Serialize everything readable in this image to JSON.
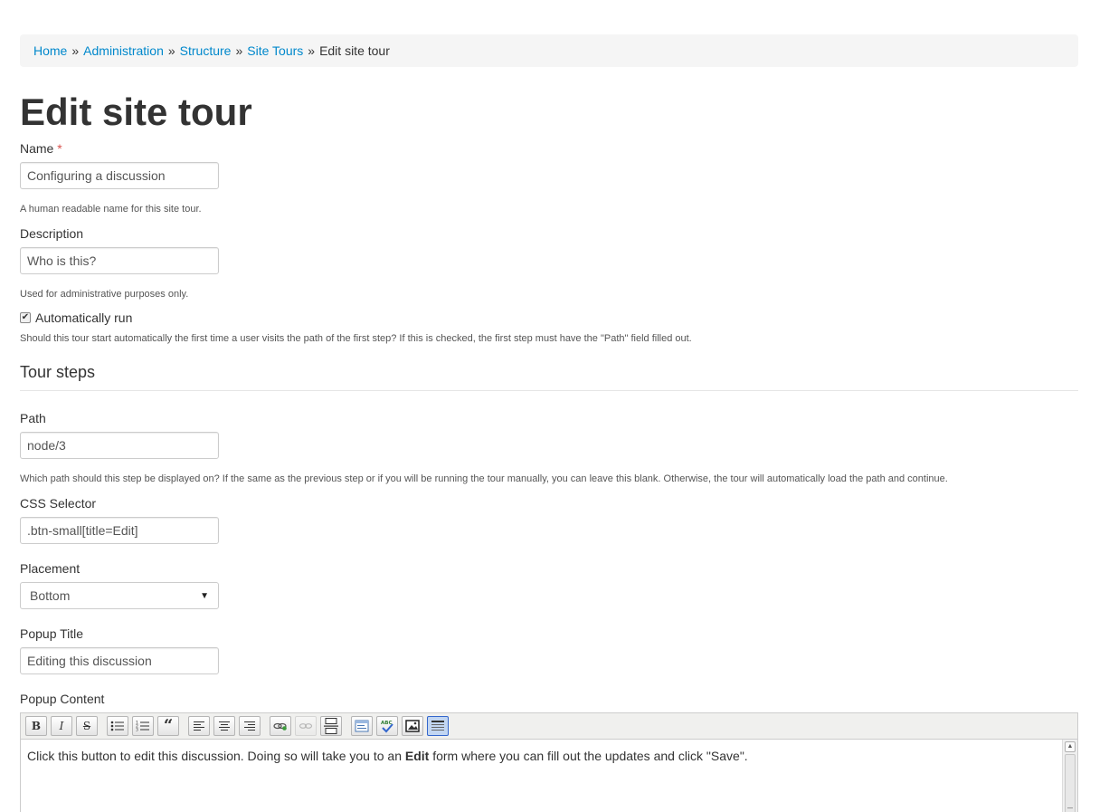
{
  "breadcrumb": {
    "items": [
      "Home",
      "Administration",
      "Structure",
      "Site Tours"
    ],
    "separator": "»",
    "current": "Edit site tour"
  },
  "page_title": "Edit site tour",
  "form": {
    "name": {
      "label": "Name",
      "required_marker": "*",
      "value": "Configuring a discussion",
      "help": "A human readable name for this site tour."
    },
    "description": {
      "label": "Description",
      "value": "Who is this?",
      "help": "Used for administrative purposes only."
    },
    "auto_run": {
      "label": "Automatically run",
      "checked": true,
      "help": "Should this tour start automatically the first time a user visits the path of the first step? If this is checked, the first step must have the \"Path\" field filled out."
    }
  },
  "tour_steps": {
    "heading": "Tour steps",
    "path": {
      "label": "Path",
      "value": "node/3",
      "help": "Which path should this step be displayed on? If the same as the previous step or if you will be running the tour manually, you can leave this blank. Otherwise, the tour will automatically load the path and continue."
    },
    "css_selector": {
      "label": "CSS Selector",
      "value": ".btn-small[title=Edit]"
    },
    "placement": {
      "label": "Placement",
      "selected": "Bottom"
    },
    "popup_title": {
      "label": "Popup Title",
      "value": "Editing this discussion"
    },
    "popup_content": {
      "label": "Popup Content",
      "text_before": "Click this button to edit this discussion. Doing so will take you to an ",
      "text_bold": "Edit",
      "text_after": " form where you can fill out the updates and click \"Save\"."
    }
  },
  "editor_toolbar": {
    "bold": "B",
    "italic": "I",
    "strike": "S",
    "icons": [
      "bold-icon",
      "italic-icon",
      "strikethrough-icon",
      "bulleted-list-icon",
      "numbered-list-icon",
      "blockquote-icon",
      "align-left-icon",
      "align-center-icon",
      "align-right-icon",
      "link-icon",
      "unlink-icon",
      "page-break-icon",
      "source-icon",
      "spellcheck-icon",
      "image-icon",
      "show-blocks-icon"
    ]
  },
  "colors": {
    "link": "#0088cc",
    "required": "#d9534f",
    "active_tool": "#c2d6f2"
  }
}
